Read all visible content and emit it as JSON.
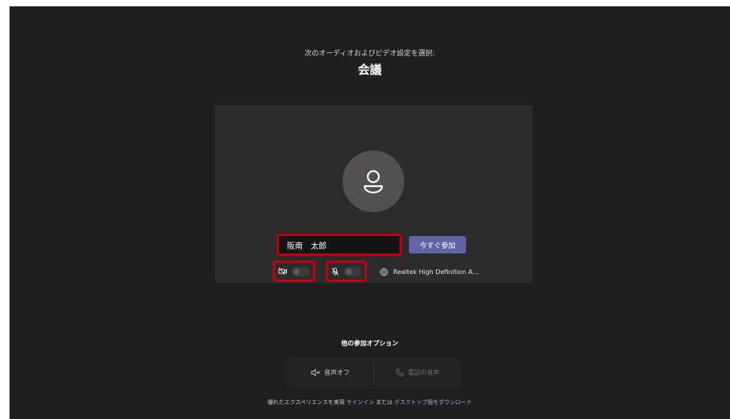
{
  "header": {
    "subtitle": "次のオーディオおよびビデオ設定を選択:",
    "title": "会議"
  },
  "preview": {
    "name_value": "阪南　太郎",
    "join_button_label": "今すぐ参加",
    "camera_on": false,
    "mic_on": false,
    "audio_device": "Realtek High Definition A..."
  },
  "other_options": {
    "heading": "他の参加オプション",
    "audio_off_label": "音声オフ",
    "phone_audio_label": "電話の音声"
  },
  "footer": {
    "text_before": "優れたエクスペリエンスを実現 ",
    "signin_link": "サインイン",
    "text_middle": " または ",
    "desktop_link": "デスクトップ版をダウンロード"
  },
  "colors": {
    "background": "#201f1f",
    "panel": "#2d2c2c",
    "accent": "#6264a7",
    "highlight": "#c3000d"
  }
}
